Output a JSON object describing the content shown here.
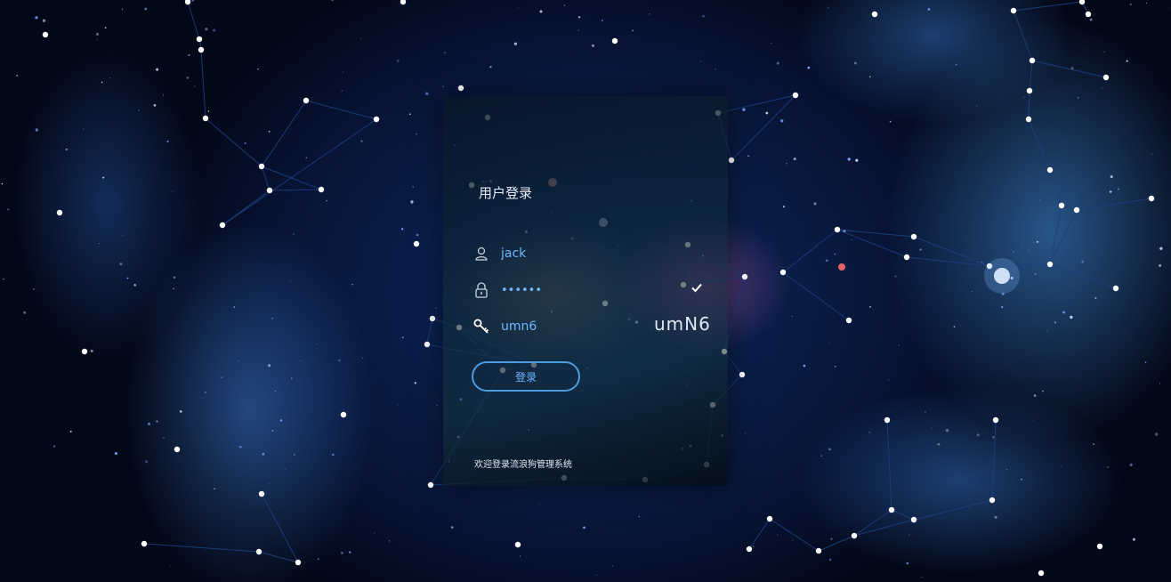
{
  "login": {
    "title": "用户登录",
    "username_value": "jack",
    "password_mask": "••••••",
    "captcha_input_value": "umn6",
    "captcha_image_text": "umN6",
    "submit_label": "登录",
    "footer_text": "欢迎登录流浪狗管理系统"
  },
  "icons": {
    "user": "user-icon",
    "lock": "lock-icon",
    "key": "key-icon",
    "check": "check-icon"
  },
  "colors": {
    "accent": "#6fb7ff",
    "button_border": "#4a9be0",
    "title_text": "#e8eef8"
  }
}
